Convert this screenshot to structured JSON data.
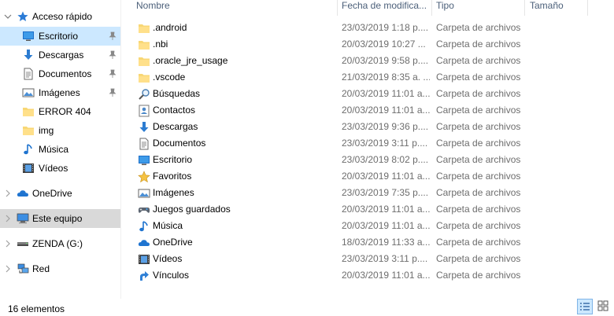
{
  "nav": {
    "items": [
      {
        "label": "Acceso rápido",
        "icon": "star-icon",
        "level": 0,
        "expanded": true,
        "state": ""
      },
      {
        "label": "Escritorio",
        "icon": "desktop-icon",
        "level": 1,
        "pin": true,
        "state": "pinsel"
      },
      {
        "label": "Descargas",
        "icon": "download-arrow-icon",
        "level": 1,
        "pin": true,
        "state": ""
      },
      {
        "label": "Documentos",
        "icon": "document-icon",
        "level": 1,
        "pin": true,
        "state": ""
      },
      {
        "label": "Imágenes",
        "icon": "pictures-icon",
        "level": 1,
        "pin": true,
        "state": ""
      },
      {
        "label": "ERROR 404",
        "icon": "folder-icon",
        "level": 1,
        "state": ""
      },
      {
        "label": "img",
        "icon": "folder-icon",
        "level": 1,
        "state": ""
      },
      {
        "label": "Música",
        "icon": "music-note-icon",
        "level": 1,
        "state": ""
      },
      {
        "label": "Vídeos",
        "icon": "film-icon",
        "level": 1,
        "state": ""
      },
      {
        "label": "OneDrive",
        "icon": "cloud-icon",
        "level": 0,
        "state": ""
      },
      {
        "label": "Este equipo",
        "icon": "computer-icon",
        "level": 0,
        "state": "selected"
      },
      {
        "label": "ZENDA (G:)",
        "icon": "drive-icon",
        "level": 0,
        "state": ""
      },
      {
        "label": "Red",
        "icon": "network-icon",
        "level": 0,
        "state": ""
      }
    ]
  },
  "columns": {
    "name": "Nombre",
    "date": "Fecha de modifica...",
    "type": "Tipo",
    "size": "Tamaño"
  },
  "files": [
    {
      "name": ".android",
      "date": "23/03/2019 1:18 p....",
      "type": "Carpeta de archivos",
      "icon": "folder-icon"
    },
    {
      "name": ".nbi",
      "date": "20/03/2019 10:27 ...",
      "type": "Carpeta de archivos",
      "icon": "folder-icon"
    },
    {
      "name": ".oracle_jre_usage",
      "date": "20/03/2019 9:58 p....",
      "type": "Carpeta de archivos",
      "icon": "folder-icon"
    },
    {
      "name": ".vscode",
      "date": "21/03/2019 8:35 a. ...",
      "type": "Carpeta de archivos",
      "icon": "folder-icon"
    },
    {
      "name": "Búsquedas",
      "date": "20/03/2019 11:01 a...",
      "type": "Carpeta de archivos",
      "icon": "search-icon"
    },
    {
      "name": "Contactos",
      "date": "20/03/2019 11:01 a...",
      "type": "Carpeta de archivos",
      "icon": "contacts-icon"
    },
    {
      "name": "Descargas",
      "date": "23/03/2019 9:36 p....",
      "type": "Carpeta de archivos",
      "icon": "download-arrow-icon"
    },
    {
      "name": "Documentos",
      "date": "23/03/2019 3:11 p....",
      "type": "Carpeta de archivos",
      "icon": "document-icon"
    },
    {
      "name": "Escritorio",
      "date": "23/03/2019 8:02 p....",
      "type": "Carpeta de archivos",
      "icon": "desktop-icon"
    },
    {
      "name": "Favoritos",
      "date": "20/03/2019 11:01 a...",
      "type": "Carpeta de archivos",
      "icon": "star-icon"
    },
    {
      "name": "Imágenes",
      "date": "23/03/2019 7:35 p....",
      "type": "Carpeta de archivos",
      "icon": "pictures-icon"
    },
    {
      "name": "Juegos guardados",
      "date": "20/03/2019 11:01 a...",
      "type": "Carpeta de archivos",
      "icon": "gamepad-icon"
    },
    {
      "name": "Música",
      "date": "20/03/2019 11:01 a...",
      "type": "Carpeta de archivos",
      "icon": "music-note-icon"
    },
    {
      "name": "OneDrive",
      "date": "18/03/2019 11:33 a...",
      "type": "Carpeta de archivos",
      "icon": "cloud-icon"
    },
    {
      "name": "Vídeos",
      "date": "23/03/2019 3:11 p....",
      "type": "Carpeta de archivos",
      "icon": "film-icon"
    },
    {
      "name": "Vínculos",
      "date": "20/03/2019 11:01 a...",
      "type": "Carpeta de archivos",
      "icon": "link-arrow-icon"
    }
  ],
  "status": {
    "count": "16 elementos",
    "view_details": "details-view",
    "view_icons": "large-icons-view"
  }
}
